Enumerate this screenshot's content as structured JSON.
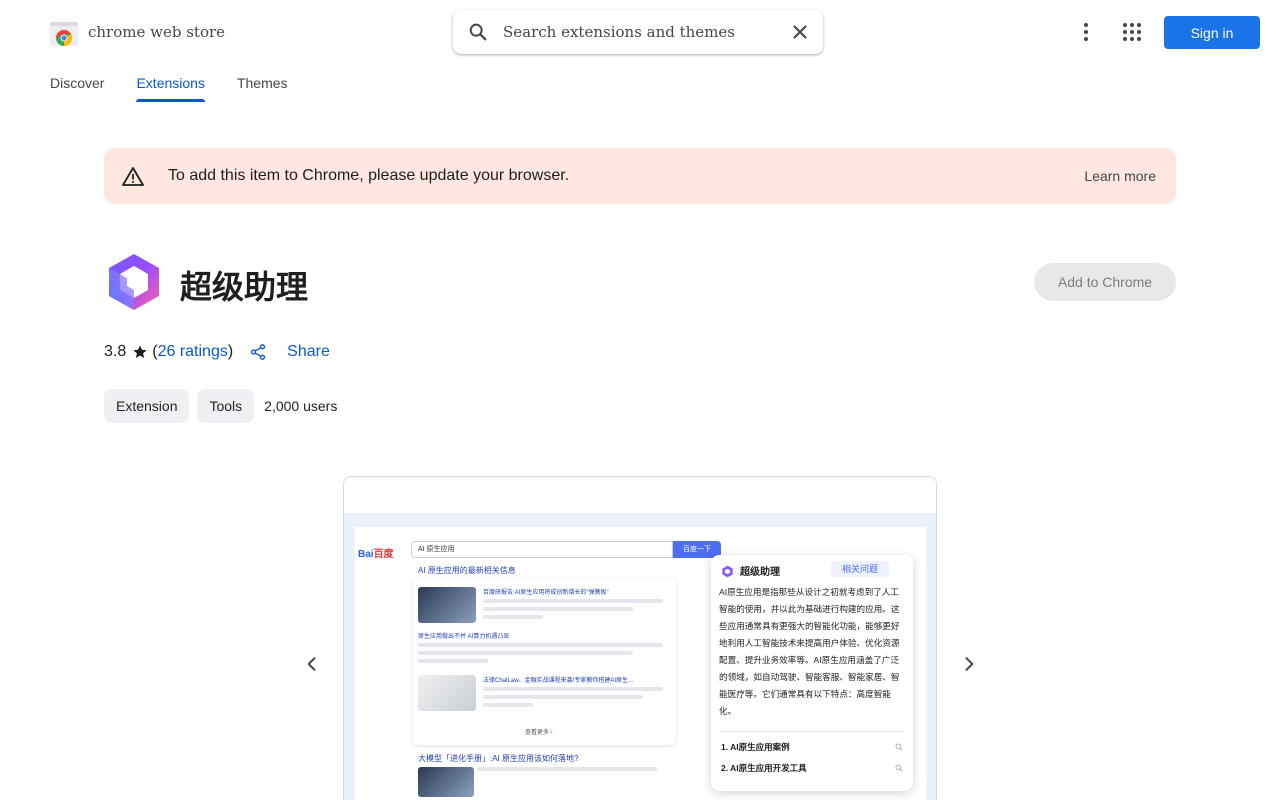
{
  "header": {
    "logo_text": "chrome web store",
    "search_placeholder": "Search extensions and themes",
    "signin_label": "Sign in"
  },
  "tabs": [
    {
      "label": "Discover"
    },
    {
      "label": "Extensions"
    },
    {
      "label": "Themes"
    }
  ],
  "banner": {
    "message": "To add this item to Chrome, please update your browser.",
    "learn_more": "Learn more"
  },
  "item": {
    "title": "超级助理",
    "add_button": "Add to Chrome",
    "rating": "3.8",
    "ratings_open": "(",
    "ratings_link": "26 ratings",
    "ratings_close": ")",
    "share_label": "Share",
    "chips": [
      "Extension",
      "Tools"
    ],
    "users": "2,000 users"
  },
  "screenshot": {
    "baidu_logo_a": "Bai",
    "baidu_logo_b": "百度",
    "query": "AI 原生应用",
    "search_button": "百度一下",
    "head_link": "AI 原生应用的最新相关信息",
    "result_titles": [
      "百度研报告:AI原生应用将成创新增长的\"弹簧板\"",
      "原生应用做出不并 AI算力机遇凸显",
      "法律ChatLaw、金融实战课程来袭!专家教你搭建AI原生..."
    ],
    "more_link": "查看更多 ›",
    "bottom_link": "大模型「进化手册」:AI 原生应用该如何落地?",
    "assistant_title": "超级助理",
    "assistant_tag": "相关问题",
    "assistant_body": "AI原生应用是指那些从设计之初就考虑到了人工智能的使用，并以此为基础进行构建的应用。这些应用通常具有更强大的智能化功能，能够更好地利用人工智能技术来提高用户体验、优化资源配置、提升业务效率等。AI原生应用涵盖了广泛的领域，如自动驾驶、智能客服、智能家居、智能医疗等。它们通常具有以下特点：高度智能化。",
    "questions": [
      "1. AI原生应用案例",
      "2. AI原生应用开发工具"
    ]
  },
  "colors": {
    "accent": "#0b57d0",
    "signin_bg": "#1a73e8",
    "banner_bg": "#fde7df"
  }
}
